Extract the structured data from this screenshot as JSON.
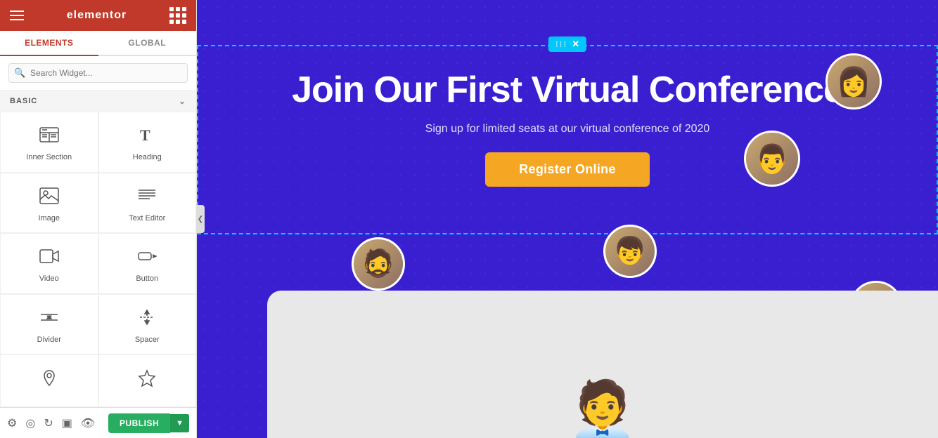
{
  "topbar": {
    "brand": "elementor"
  },
  "tabs": {
    "elements_label": "ELEMENTS",
    "global_label": "GLOBAL"
  },
  "search": {
    "placeholder": "Search Widget..."
  },
  "section_basic": {
    "label": "BASIC"
  },
  "widgets": [
    {
      "id": "inner-section",
      "label": "Inner Section",
      "icon": "inner-section-icon"
    },
    {
      "id": "heading",
      "label": "Heading",
      "icon": "heading-icon"
    },
    {
      "id": "image",
      "label": "Image",
      "icon": "image-icon"
    },
    {
      "id": "text-editor",
      "label": "Text Editor",
      "icon": "text-editor-icon"
    },
    {
      "id": "video",
      "label": "Video",
      "icon": "video-icon"
    },
    {
      "id": "button",
      "label": "Button",
      "icon": "button-icon"
    },
    {
      "id": "divider",
      "label": "Divider",
      "icon": "divider-icon"
    },
    {
      "id": "spacer",
      "label": "Spacer",
      "icon": "spacer-icon"
    },
    {
      "id": "widget8",
      "label": "",
      "icon": "map-icon"
    },
    {
      "id": "widget9",
      "label": "",
      "icon": "star-icon"
    }
  ],
  "canvas": {
    "hero_title": "Join Our First Virtual Conference",
    "hero_subtitle": "Sign up for limited seats at our virtual conference of 2020",
    "register_button": "Register Online"
  },
  "toolbar": {
    "publish_label": "PUBLISH"
  }
}
